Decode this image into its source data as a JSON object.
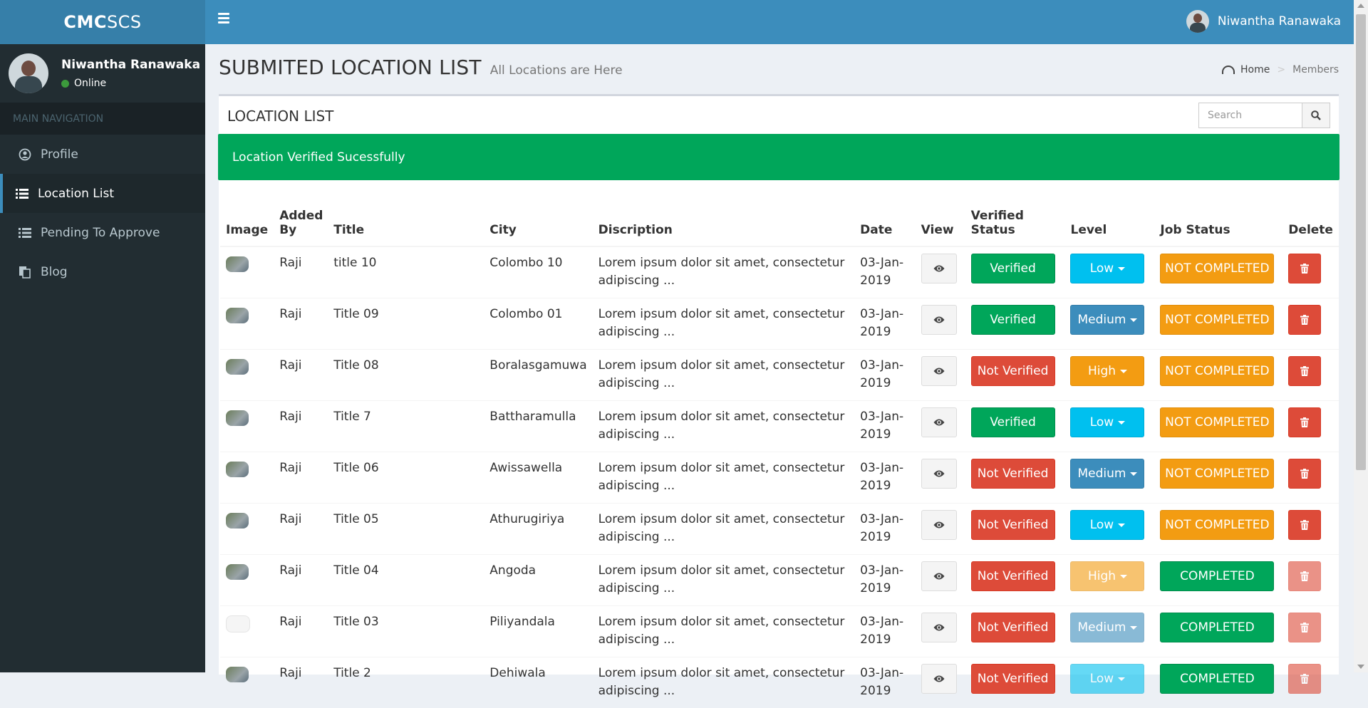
{
  "brand": {
    "bold": "CMC",
    "light": "SCS"
  },
  "user": {
    "name": "Niwantha Ranawaka",
    "status": "Online"
  },
  "sidebar": {
    "header": "MAIN NAVIGATION",
    "items": [
      {
        "label": "Profile",
        "icon": "user-circle-icon"
      },
      {
        "label": "Location List",
        "icon": "list-icon"
      },
      {
        "label": "Pending To Approve",
        "icon": "list-icon"
      },
      {
        "label": "Blog",
        "icon": "copy-icon"
      }
    ]
  },
  "page": {
    "title": "SUBMITED LOCATION LIST",
    "subtitle": "All Locations are Here"
  },
  "breadcrumb": {
    "home": "Home",
    "current": "Members"
  },
  "box": {
    "title": "LOCATION LIST",
    "search_placeholder": "Search"
  },
  "alert": "Location Verified Sucessfully",
  "table": {
    "headers": [
      "Image",
      "Added By",
      "Title",
      "City",
      "Discription",
      "Date",
      "View",
      "Verified Status",
      "Level",
      "Job Status",
      "Delete"
    ],
    "rows": [
      {
        "by": "Raji",
        "title": "title 10",
        "city": "Colombo 10",
        "desc1": "Lorem ipsum dolor sit amet, consectetur",
        "desc2": "adipiscing ...",
        "date1": "03-Jan-",
        "date2": "2019",
        "verified": "Verified",
        "level": "Low",
        "job": "NOT COMPLETED"
      },
      {
        "by": "Raji",
        "title": "Title 09",
        "city": "Colombo 01",
        "desc1": "Lorem ipsum dolor sit amet, consectetur",
        "desc2": "adipiscing ...",
        "date1": "03-Jan-",
        "date2": "2019",
        "verified": "Verified",
        "level": "Medium",
        "job": "NOT COMPLETED"
      },
      {
        "by": "Raji",
        "title": "Title 08",
        "city": "Boralasgamuwa",
        "desc1": "Lorem ipsum dolor sit amet, consectetur",
        "desc2": "adipiscing ...",
        "date1": "03-Jan-",
        "date2": "2019",
        "verified": "Not Verified",
        "level": "High",
        "job": "NOT COMPLETED"
      },
      {
        "by": "Raji",
        "title": "Title 7",
        "city": "Battharamulla",
        "desc1": "Lorem ipsum dolor sit amet, consectetur",
        "desc2": "adipiscing ...",
        "date1": "03-Jan-",
        "date2": "2019",
        "verified": "Verified",
        "level": "Low",
        "job": "NOT COMPLETED"
      },
      {
        "by": "Raji",
        "title": "Title 06",
        "city": "Awissawella",
        "desc1": "Lorem ipsum dolor sit amet, consectetur",
        "desc2": "adipiscing ...",
        "date1": "03-Jan-",
        "date2": "2019",
        "verified": "Not Verified",
        "level": "Medium",
        "job": "NOT COMPLETED"
      },
      {
        "by": "Raji",
        "title": "Title 05",
        "city": "Athurugiriya",
        "desc1": "Lorem ipsum dolor sit amet, consectetur",
        "desc2": "adipiscing ...",
        "date1": "03-Jan-",
        "date2": "2019",
        "verified": "Not Verified",
        "level": "Low",
        "job": "NOT COMPLETED"
      },
      {
        "by": "Raji",
        "title": "Title 04",
        "city": "Angoda",
        "desc1": "Lorem ipsum dolor sit amet, consectetur",
        "desc2": "adipiscing ...",
        "date1": "03-Jan-",
        "date2": "2019",
        "verified": "Not Verified",
        "level": "High",
        "job": "COMPLETED"
      },
      {
        "by": "Raji",
        "title": "Title 03",
        "city": "Piliyandala",
        "desc1": "Lorem ipsum dolor sit amet, consectetur",
        "desc2": "adipiscing ...",
        "date1": "03-Jan-",
        "date2": "2019",
        "verified": "Not Verified",
        "level": "Medium",
        "job": "COMPLETED"
      },
      {
        "by": "Raji",
        "title": "Title 2",
        "city": "Dehiwala",
        "desc1": "Lorem ipsum dolor sit amet, consectetur",
        "desc2": "adipiscing ...",
        "date1": "03-Jan-",
        "date2": "2019",
        "verified": "Not Verified",
        "level": "Low",
        "job": "COMPLETED"
      }
    ]
  },
  "colors": {
    "primary": "#3c8dbc",
    "success": "#00a65a",
    "danger": "#dd4b39",
    "info": "#00c0ef",
    "warning": "#f39c12",
    "sidebar": "#222d32"
  }
}
